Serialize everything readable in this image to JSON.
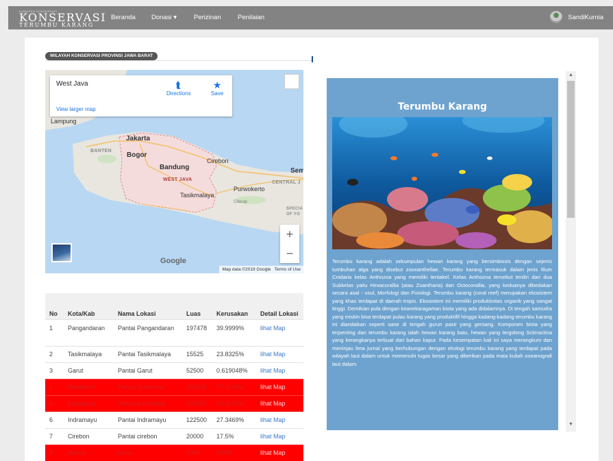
{
  "navbar": {
    "brand_small": "KAWASAN KONSERVASI",
    "brand_main": "KONSERVASI",
    "brand_sub": "TERUMBU KARANG",
    "items": [
      "Beranda",
      "Donasi ▾",
      "Perizinan",
      "Penilaian"
    ],
    "user": "SandiKurnia"
  },
  "section": {
    "badge": "WILAYAH KONSERVASI PROVINSI JAWA BARAT"
  },
  "map": {
    "card_title": "West Java",
    "directions": "Directions",
    "save": "Save",
    "view_larger": "View larger map",
    "zoom_in": "+",
    "zoom_out": "−",
    "google": "Google",
    "footer_data": "Map data ©2019 Google",
    "footer_terms": "Terms of Use",
    "labels": {
      "lampung": "Lampung",
      "banten": "BANTEN",
      "jakarta": "Jakarta",
      "bogor": "Bogor",
      "bandung": "Bandung",
      "cirebon": "Cirebon",
      "west_java": "WEST JAVA",
      "tasikmalaya": "Tasikmalaya",
      "purwokerto": "Purwokerto",
      "cilacap": "Cilacap",
      "central_j": "CENTRAL J",
      "sem": "Sem",
      "special": "SPECIA",
      "of_yo": "OF YO"
    }
  },
  "table": {
    "headers": [
      "No",
      "Kota/Kab",
      "Nama Lokasi",
      "Luas",
      "Kerusakan",
      "Detail Lokasi"
    ],
    "rows": [
      {
        "no": "1",
        "kota": "Pangandaran",
        "lokasi": "Pantai Pangandaran",
        "luas": "197478",
        "kerusakan": "39.9999%",
        "detail": "lihat Map",
        "danger": false,
        "tall": true
      },
      {
        "no": "2",
        "kota": "Tasikmalaya",
        "lokasi": "Pantai Tasikmalaya",
        "luas": "15525",
        "kerusakan": "23.8325%",
        "detail": "lihat Map",
        "danger": false,
        "tall": false
      },
      {
        "no": "3",
        "kota": "Garut",
        "lokasi": "Pantai Garut",
        "luas": "52500",
        "kerusakan": "0.619048%",
        "detail": "lihat Map",
        "danger": false,
        "tall": false
      },
      {
        "no": "4",
        "kota": "Sukabumi",
        "lokasi": "Pantai Sukabumi",
        "luas": "156220",
        "kerusakan": "57.9548%",
        "detail": "lihat Map",
        "danger": true,
        "tall": false
      },
      {
        "no": "5",
        "kota": "Karawang",
        "lokasi": "Pantai Karawang",
        "luas": "209197",
        "kerusakan": "55.1033%",
        "detail": "lihat Map",
        "danger": true,
        "tall": false
      },
      {
        "no": "6",
        "kota": "Indramayu",
        "lokasi": "Pantai Indramayu",
        "luas": "122500",
        "kerusakan": "27.3469%",
        "detail": "lihat Map",
        "danger": false,
        "tall": false
      },
      {
        "no": "7",
        "kota": "Cirebon",
        "lokasi": "Pantai cirebon",
        "luas": "20000",
        "kerusakan": "17.5%",
        "detail": "lihat Map",
        "danger": false,
        "tall": false
      },
      {
        "no": "8",
        "kota": "dianus",
        "lokasi": "haha",
        "luas": "1000",
        "kerusakan": "100%",
        "detail": "lihat Map",
        "danger": true,
        "tall": false
      }
    ]
  },
  "info": {
    "title": "Terumbu Karang",
    "text": "Terumbu karang adalah sekumpulan hewan karang yang bersimbiosis dengan sejenis tumbuhan alga yang disebut zooxanthellae. Terumbu karang termasuk dalam jenis filum Cnidaria kelas Anthozoa yang memiliki tentakel. Kelas Anthozoa tersebut terdiri dari dua Subkelas yaitu Hexacorallia (atau Zoantharia) dan Octocorallia, yang keduanya dibedakan secara asal - usul, Morfologi dan Fisiologi. Terumbu karang (coral reef) merupakan ekosistem yang khas terdapat di daerah tropis. Ekosistem ini memiliki produktivitas organik yang sangat tinggi. Demikian pula dengan keanekaragaman biota yang ada didalamnya. Di tengah samudra yang miskin bisa terdapat pulau karang yang produktifif hingga kadang-kadang terumbu karang ini diandaikan seperti oase di tengah gurun pasir yang gersang. Komponen biota yang terpenting dari terumbu karang ialah hewan karang batu, hewan yang tergolong Scleractina yang kerangkanya terbuat dari bahan kapur. Pada kesempatan kali ini saya merangkum dan meninjau lima jurnal yang berhubungan dengan ekologi terumbu karang yang terdapat pada wilayah laut dalam untuk memenuhi tugas besar yang diberikan pada mata kuliah oseanografi laut dalam."
  },
  "colors": {
    "navbar": "#838383",
    "info_bg": "#6ea3cf",
    "danger": "#ff0000",
    "link": "#3c78c8"
  },
  "icons": [
    "directions-icon",
    "star-icon",
    "fullscreen-icon",
    "chevron-up-icon",
    "chevron-down-icon"
  ]
}
